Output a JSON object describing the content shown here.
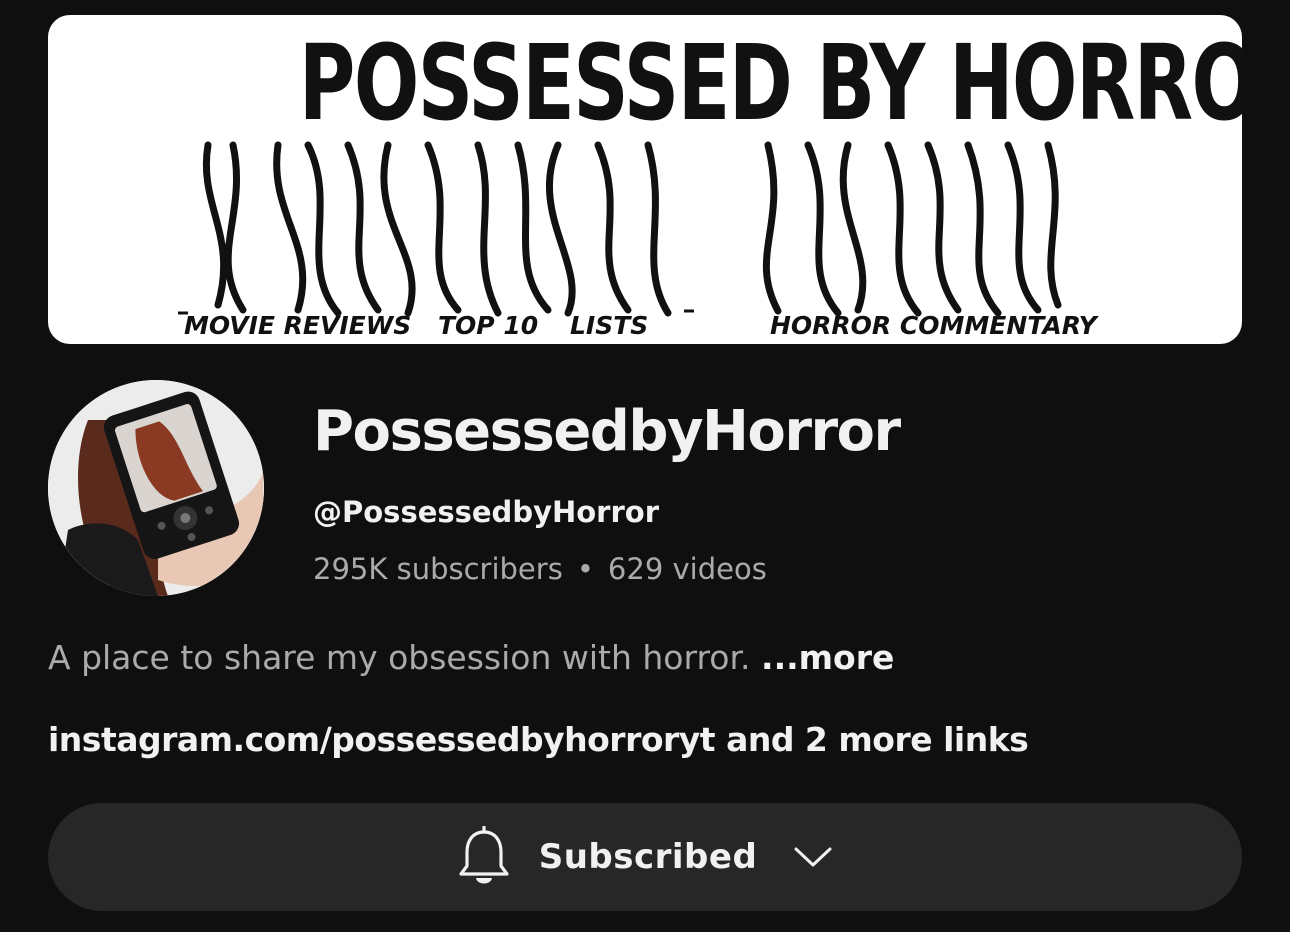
{
  "banner": {
    "title": "POSSESSED BY HORROR",
    "tags": [
      "MOVIE REVIEWS",
      "TOP 10",
      "LISTS",
      "HORROR COMMENTARY"
    ]
  },
  "channel": {
    "name": "PossessedbyHorror",
    "handle": "@PossessedbyHorror",
    "subscribers": "295K subscribers",
    "separator": "•",
    "videos": "629 videos",
    "description": "A place to share my obsession with horror.",
    "more_label": "...more",
    "links_text": "instagram.com/possessedbyhorroryt and 2 more links"
  },
  "subscribe_button": {
    "label": "Subscribed",
    "bell_icon": "bell-icon",
    "chevron_icon": "chevron-down-icon"
  },
  "colors": {
    "background": "#0f0f0f",
    "primary_text": "#f1f1f1",
    "secondary_text": "#aaaaaa",
    "button_bg": "#272727",
    "banner_bg": "#ffffff"
  }
}
